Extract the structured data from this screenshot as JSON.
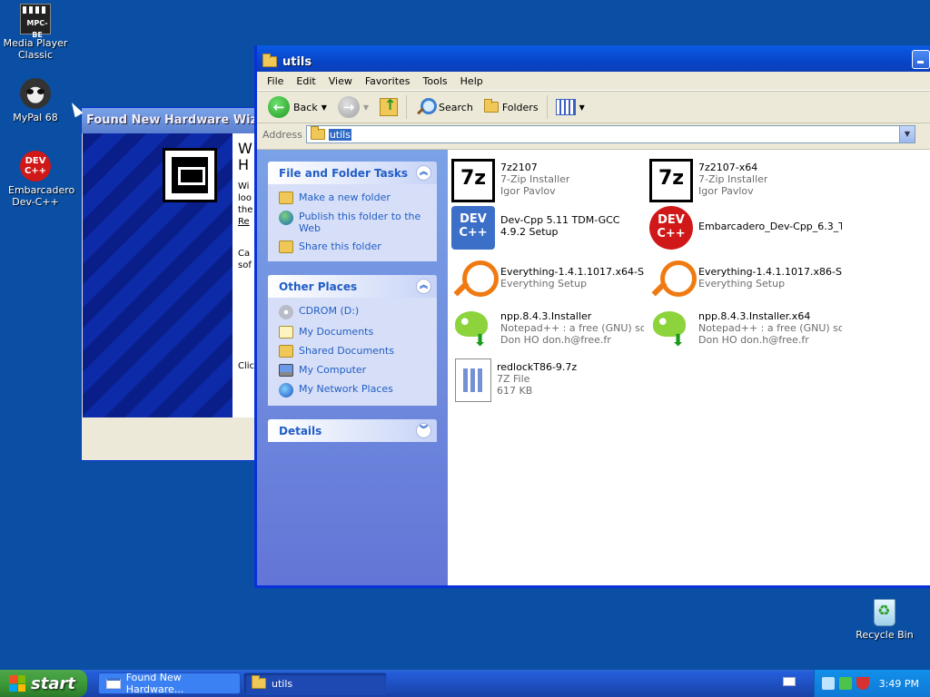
{
  "desktop": {
    "icons": [
      {
        "label": "Media Player Classic",
        "icon": "media-player-icon"
      },
      {
        "label": "MyPal 68",
        "icon": "raccoon-icon"
      },
      {
        "label": "Embarcadero Dev-C++",
        "icon": "devcpp-icon"
      }
    ],
    "recycle_bin": "Recycle Bin",
    "mpc_icon_text": "MPC-BE",
    "dev_icon_text_1": "DEV",
    "dev_icon_text_2": "C++"
  },
  "wizard": {
    "title": "Found New Hardware Wizard",
    "text_fragments": [
      "W",
      "H",
      "Wi",
      "loo",
      "the",
      "Re",
      "Ca",
      "sof",
      "Clic"
    ]
  },
  "explorer": {
    "title": "utils",
    "menu": [
      "File",
      "Edit",
      "View",
      "Favorites",
      "Tools",
      "Help"
    ],
    "toolbar": {
      "back": "Back",
      "search": "Search",
      "folders": "Folders"
    },
    "address": {
      "label": "Address",
      "value": "utils"
    },
    "task_pane": {
      "file_folder_tasks": {
        "title": "File and Folder Tasks",
        "items": [
          "Make a new folder",
          "Publish this folder to the Web",
          "Share this folder"
        ]
      },
      "other_places": {
        "title": "Other Places",
        "items": [
          "CDROM (D:)",
          "My Documents",
          "Shared Documents",
          "My Computer",
          "My Network Places"
        ]
      },
      "details": {
        "title": "Details"
      }
    },
    "files": [
      {
        "name": "7z2107",
        "line2": "7-Zip Installer",
        "line3": "Igor Pavlov",
        "icon_text": "7z"
      },
      {
        "name": "7z2107-x64",
        "line2": "7-Zip Installer",
        "line3": "Igor Pavlov",
        "icon_text": "7z"
      },
      {
        "name": "Dev-Cpp 5.11 TDM-GCC 4.9.2 Setup",
        "icon_text_1": "DEV",
        "icon_text_2": "C++"
      },
      {
        "name": "Embarcadero_Dev-Cpp_6.3_T...",
        "icon_text_1": "DEV",
        "icon_text_2": "C++"
      },
      {
        "name": "Everything-1.4.1.1017.x64-S...",
        "line2": "Everything Setup"
      },
      {
        "name": "Everything-1.4.1.1017.x86-S...",
        "line2": "Everything Setup"
      },
      {
        "name": "npp.8.4.3.Installer",
        "line2": "Notepad++ : a free (GNU) so...",
        "line3": "Don HO don.h@free.fr"
      },
      {
        "name": "npp.8.4.3.Installer.x64",
        "line2": "Notepad++ : a free (GNU) so...",
        "line3": "Don HO don.h@free.fr"
      },
      {
        "name": "redlockT86-9.7z",
        "line2": "7Z File",
        "line3": "617 KB"
      }
    ]
  },
  "taskbar": {
    "start": "start",
    "buttons": [
      "Found New Hardware...",
      "utils"
    ],
    "clock": "3:49 PM"
  },
  "colors": {
    "desktop": "#0a4fa3",
    "taskpane_link": "#215dc6",
    "start_green": "#3c9a38"
  }
}
